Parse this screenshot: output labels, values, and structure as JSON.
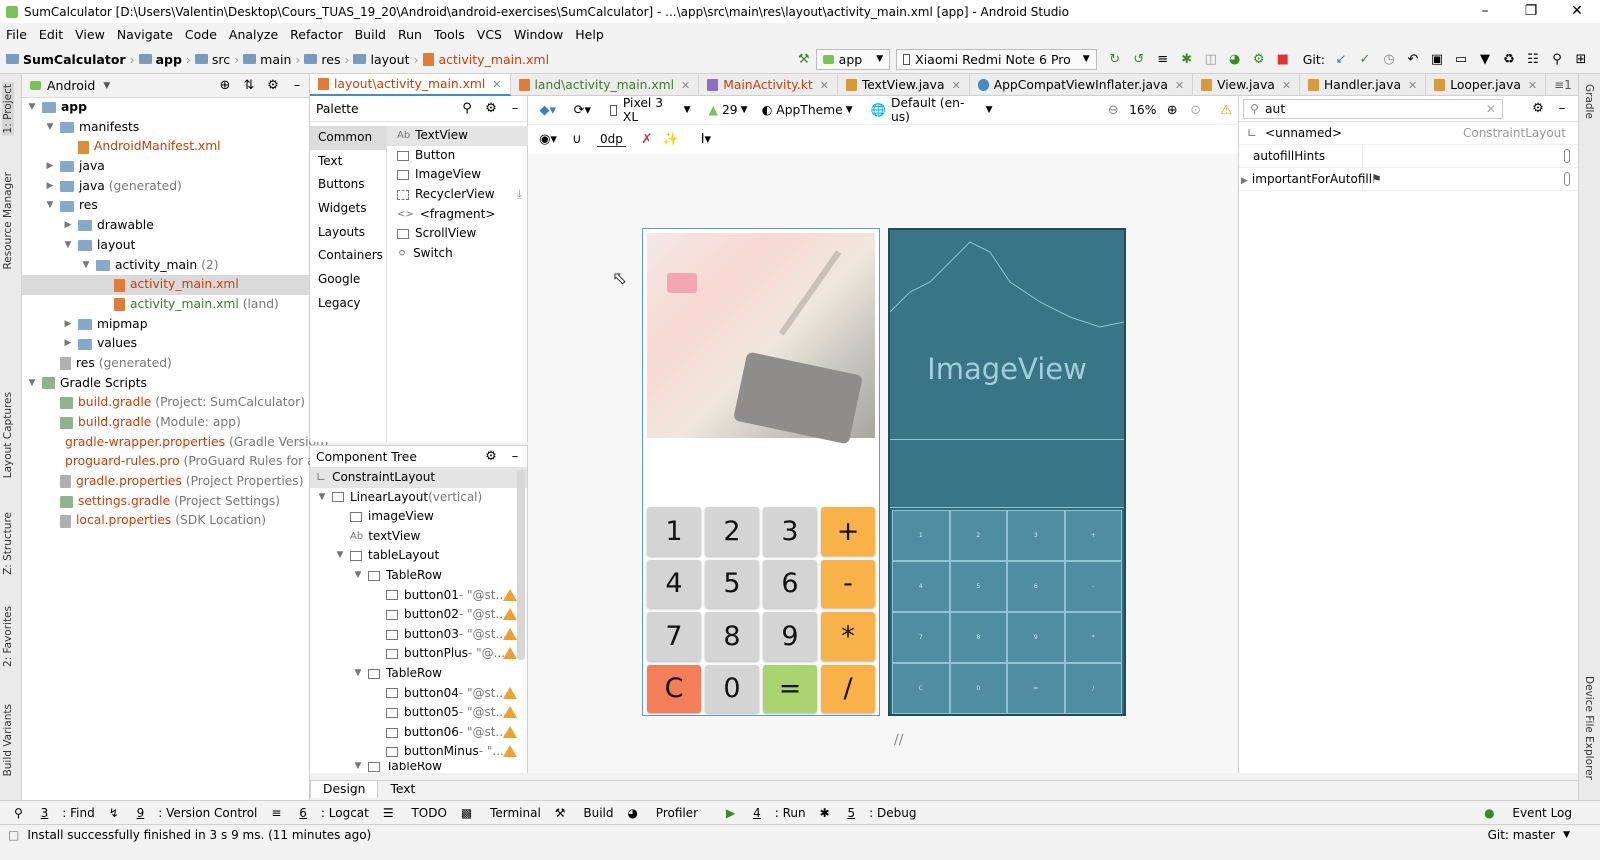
{
  "window": {
    "title": "SumCalculator [D:\\Users\\Valentin\\Desktop\\Cours_TUAS_19_20\\Android\\android-exercises\\SumCalculator] - ...\\app\\src\\main\\res\\layout\\activity_main.xml [app] - Android Studio"
  },
  "menu": [
    "File",
    "Edit",
    "View",
    "Navigate",
    "Code",
    "Analyze",
    "Refactor",
    "Build",
    "Run",
    "Tools",
    "VCS",
    "Window",
    "Help"
  ],
  "breadcrumb": [
    "SumCalculator",
    "app",
    "src",
    "main",
    "res",
    "layout",
    "activity_main.xml"
  ],
  "toolbar": {
    "run_config": "app",
    "device": "Xiaomi Redmi Note 6 Pro",
    "git_label": "Git:"
  },
  "left_strip": {
    "project": "1: Project",
    "resource_manager": "Resource Manager",
    "layout_captures": "Layout Captures",
    "structure": "Z: Structure",
    "favorites": "2: Favorites",
    "build_variants": "Build Variants"
  },
  "right_strip": {
    "gradle": "Gradle",
    "device_file_explorer": "Device File Explorer"
  },
  "project": {
    "view_mode": "Android",
    "tree": [
      {
        "label": "app",
        "note": "",
        "depth": 0
      },
      {
        "label": "manifests",
        "note": "",
        "depth": 1
      },
      {
        "label": "AndroidManifest.xml",
        "note": "",
        "depth": 2
      },
      {
        "label": "java",
        "note": "",
        "depth": 1
      },
      {
        "label": "java",
        "note": "(generated)",
        "depth": 1
      },
      {
        "label": "res",
        "note": "",
        "depth": 1
      },
      {
        "label": "drawable",
        "note": "",
        "depth": 2
      },
      {
        "label": "layout",
        "note": "",
        "depth": 2
      },
      {
        "label": "activity_main",
        "note": "(2)",
        "depth": 3
      },
      {
        "label": "activity_main.xml",
        "note": "",
        "depth": 4
      },
      {
        "label": "activity_main.xml",
        "note": "(land)",
        "depth": 4
      },
      {
        "label": "mipmap",
        "note": "",
        "depth": 2
      },
      {
        "label": "values",
        "note": "",
        "depth": 2
      },
      {
        "label": "res",
        "note": "(generated)",
        "depth": 1
      },
      {
        "label": "Gradle Scripts",
        "note": "",
        "depth": 0
      },
      {
        "label": "build.gradle",
        "note": "(Project: SumCalculator)",
        "depth": 1
      },
      {
        "label": "build.gradle",
        "note": "(Module: app)",
        "depth": 1
      },
      {
        "label": "gradle-wrapper.properties",
        "note": "(Gradle Version)",
        "depth": 1
      },
      {
        "label": "proguard-rules.pro",
        "note": "(ProGuard Rules for app)",
        "depth": 1
      },
      {
        "label": "gradle.properties",
        "note": "(Project Properties)",
        "depth": 1
      },
      {
        "label": "settings.gradle",
        "note": "(Project Settings)",
        "depth": 1
      },
      {
        "label": "local.properties",
        "note": "(SDK Location)",
        "depth": 1
      }
    ]
  },
  "tabs": [
    "layout\\activity_main.xml",
    "land\\activity_main.xml",
    "MainActivity.kt",
    "TextView.java",
    "AppCompatViewInflater.java",
    "View.java",
    "Handler.java",
    "Looper.java"
  ],
  "palette": {
    "title": "Palette",
    "categories": [
      "Common",
      "Text",
      "Buttons",
      "Widgets",
      "Layouts",
      "Containers",
      "Google",
      "Legacy"
    ],
    "items": [
      "TextView",
      "Button",
      "ImageView",
      "RecyclerView",
      "<fragment>",
      "ScrollView",
      "Switch"
    ]
  },
  "design_toolbar": {
    "device": "Pixel 3 XL",
    "api": "29",
    "theme": "AppTheme",
    "locale": "Default (en-us)",
    "zoom": "16%",
    "margin": "0dp"
  },
  "component_tree": {
    "title": "Component Tree",
    "rows": [
      {
        "label": "ConstraintLayout",
        "extra": ""
      },
      {
        "label": "LinearLayout",
        "extra": "(vertical)"
      },
      {
        "label": "imageView",
        "extra": ""
      },
      {
        "label": "textView",
        "extra": ""
      },
      {
        "label": "tableLayout",
        "extra": ""
      },
      {
        "label": "TableRow",
        "extra": ""
      },
      {
        "label": "button01",
        "extra": "- \"@st..."
      },
      {
        "label": "button02",
        "extra": "- \"@st..."
      },
      {
        "label": "button03",
        "extra": "- \"@st..."
      },
      {
        "label": "buttonPlus",
        "extra": "- \"@..."
      },
      {
        "label": "TableRow",
        "extra": ""
      },
      {
        "label": "button04",
        "extra": "- \"@st..."
      },
      {
        "label": "button05",
        "extra": "- \"@st..."
      },
      {
        "label": "button06",
        "extra": "- \"@st..."
      },
      {
        "label": "buttonMinus",
        "extra": "- \"..."
      },
      {
        "label": "TableRow",
        "extra": ""
      }
    ]
  },
  "calculator": {
    "keys": [
      "1",
      "2",
      "3",
      "+",
      "4",
      "5",
      "6",
      "-",
      "7",
      "8",
      "9",
      "*",
      "C",
      "0",
      "=",
      "/"
    ],
    "blueprint_label": "ImageView"
  },
  "attributes": {
    "search": "aut",
    "component": "<unnamed>",
    "component_type": "ConstraintLayout",
    "rows": [
      "autofillHints",
      "importantForAutofill"
    ]
  },
  "editor_tabs": [
    "Design",
    "Text"
  ],
  "tool_windows": [
    {
      "num": "3",
      "label": ": Find"
    },
    {
      "num": "9",
      "label": ": Version Control"
    },
    {
      "num": "6",
      "label": ": Logcat"
    },
    {
      "num": "",
      "label": "TODO"
    },
    {
      "num": "",
      "label": "Terminal"
    },
    {
      "num": "",
      "label": "Build"
    },
    {
      "num": "",
      "label": "Profiler"
    },
    {
      "num": "4",
      "label": ": Run"
    },
    {
      "num": "5",
      "label": ": Debug"
    }
  ],
  "event_log": "Event Log",
  "status": {
    "message": "Install successfully finished in 3 s 9 ms. (11 minutes ago)",
    "git": "Git: master"
  }
}
